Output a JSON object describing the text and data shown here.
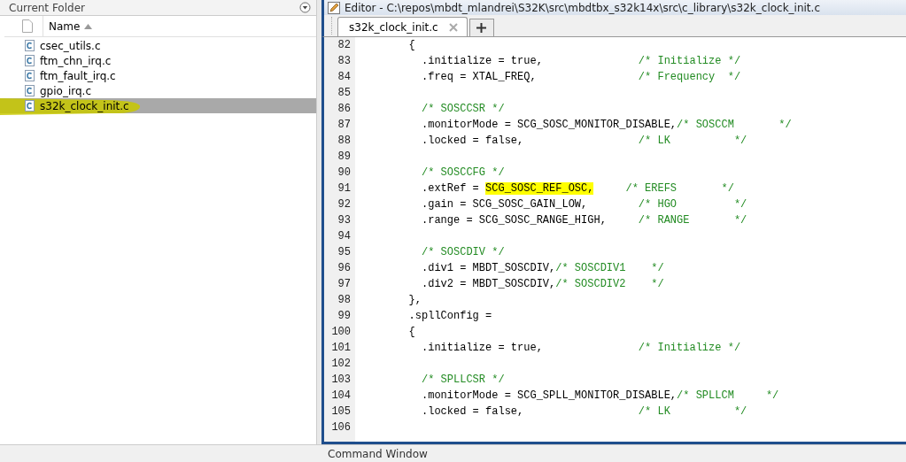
{
  "current_folder": {
    "title": "Current Folder",
    "column": "Name",
    "sort_ascending": true,
    "files": [
      {
        "name": "csec_utils.c",
        "selected": false,
        "annotated": false
      },
      {
        "name": "ftm_chn_irq.c",
        "selected": false,
        "annotated": false
      },
      {
        "name": "ftm_fault_irq.c",
        "selected": false,
        "annotated": false
      },
      {
        "name": "gpio_irq.c",
        "selected": false,
        "annotated": false
      },
      {
        "name": "s32k_clock_init.c",
        "selected": true,
        "annotated": true
      }
    ]
  },
  "editor": {
    "title": "Editor - C:\\repos\\mbdt_mlandrei\\S32K\\src\\mbdtbx_s32k14x\\src\\c_library\\s32k_clock_init.c",
    "tabs": [
      {
        "label": "s32k_clock_init.c",
        "selected": true
      }
    ],
    "lines": [
      {
        "number": "82",
        "segments": [
          {
            "kind": "code",
            "text": "        {"
          }
        ]
      },
      {
        "number": "83",
        "segments": [
          {
            "kind": "code",
            "text": "          .initialize = true,               "
          },
          {
            "kind": "comment",
            "text": "/* Initialize */"
          }
        ]
      },
      {
        "number": "84",
        "segments": [
          {
            "kind": "code",
            "text": "          .freq = XTAL_FREQ,                "
          },
          {
            "kind": "comment",
            "text": "/* Frequency  */"
          }
        ]
      },
      {
        "number": "85"
      },
      {
        "number": "86",
        "segments": [
          {
            "kind": "comment",
            "text": "          /* SOSCCSR */"
          }
        ]
      },
      {
        "number": "87",
        "segments": [
          {
            "kind": "code",
            "text": "          .monitorMode = SCG_SOSC_MONITOR_DISABLE,"
          },
          {
            "kind": "comment",
            "text": "/* SOSCCM       */"
          }
        ]
      },
      {
        "number": "88",
        "segments": [
          {
            "kind": "code",
            "text": "          .locked = false,                  "
          },
          {
            "kind": "comment",
            "text": "/* LK          */"
          }
        ]
      },
      {
        "number": "89"
      },
      {
        "number": "90",
        "segments": [
          {
            "kind": "comment",
            "text": "          /* SOSCCFG */"
          }
        ]
      },
      {
        "number": "91",
        "segments": [
          {
            "kind": "code",
            "text": "          .extRef = "
          },
          {
            "kind": "highlight",
            "text": "SCG_SOSC_REF_OSC,"
          },
          {
            "kind": "comment",
            "text": "     /* EREFS       */"
          }
        ]
      },
      {
        "number": "92",
        "segments": [
          {
            "kind": "code",
            "text": "          .gain = SCG_SOSC_GAIN_LOW,        "
          },
          {
            "kind": "comment",
            "text": "/* HGO         */"
          }
        ]
      },
      {
        "number": "93",
        "segments": [
          {
            "kind": "code",
            "text": "          .range = SCG_SOSC_RANGE_HIGH,     "
          },
          {
            "kind": "comment",
            "text": "/* RANGE       */"
          }
        ]
      },
      {
        "number": "94"
      },
      {
        "number": "95",
        "segments": [
          {
            "kind": "comment",
            "text": "          /* SOSCDIV */"
          }
        ]
      },
      {
        "number": "96",
        "segments": [
          {
            "kind": "code",
            "text": "          .div1 = MBDT_SOSCDIV,"
          },
          {
            "kind": "comment",
            "text": "/* SOSCDIV1    */"
          }
        ]
      },
      {
        "number": "97",
        "segments": [
          {
            "kind": "code",
            "text": "          .div2 = MBDT_SOSCDIV,"
          },
          {
            "kind": "comment",
            "text": "/* SOSCDIV2    */"
          }
        ]
      },
      {
        "number": "98",
        "segments": [
          {
            "kind": "code",
            "text": "        },"
          }
        ]
      },
      {
        "number": "99",
        "segments": [
          {
            "kind": "code",
            "text": "        .spllConfig ="
          }
        ]
      },
      {
        "number": "100",
        "segments": [
          {
            "kind": "code",
            "text": "        {"
          }
        ]
      },
      {
        "number": "101",
        "segments": [
          {
            "kind": "code",
            "text": "          .initialize = true,               "
          },
          {
            "kind": "comment",
            "text": "/* Initialize */"
          }
        ]
      },
      {
        "number": "102"
      },
      {
        "number": "103",
        "segments": [
          {
            "kind": "comment",
            "text": "          /* SPLLCSR */"
          }
        ]
      },
      {
        "number": "104",
        "segments": [
          {
            "kind": "code",
            "text": "          .monitorMode = SCG_SPLL_MONITOR_DISABLE,"
          },
          {
            "kind": "comment",
            "text": "/* SPLLCM     */"
          }
        ]
      },
      {
        "number": "105",
        "segments": [
          {
            "kind": "code",
            "text": "          .locked = false,                  "
          },
          {
            "kind": "comment",
            "text": "/* LK          */"
          }
        ]
      },
      {
        "number": "106"
      }
    ]
  },
  "command_window": {
    "title": "Command Window"
  }
}
